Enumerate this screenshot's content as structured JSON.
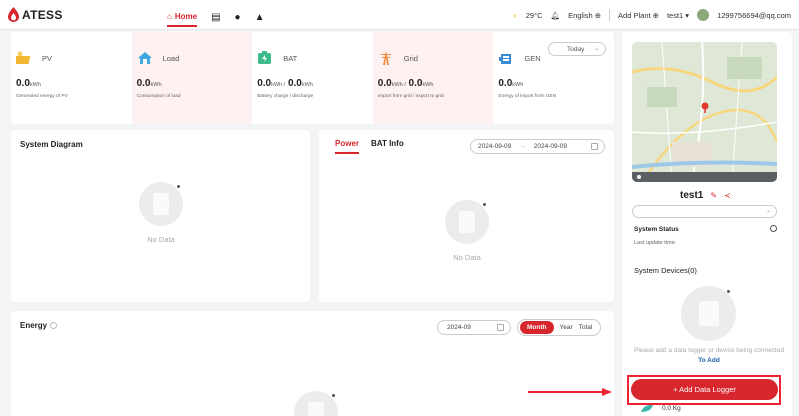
{
  "header": {
    "logo_text": "ATESS",
    "nav": {
      "home_label": "Home"
    },
    "weather": "29°C",
    "language": "English",
    "add_plant": "Add Plant",
    "plant_select": "test1",
    "account": "1299756694@qq.com"
  },
  "stats": {
    "period_select": "Today",
    "items": [
      {
        "name": "PV",
        "value": "0.0",
        "unit": "kWh",
        "desc": "Generated energy of PV"
      },
      {
        "name": "Load",
        "value": "0.0",
        "unit": "kWh",
        "desc": "Consumption of load"
      },
      {
        "name": "BAT",
        "value1": "0.0",
        "unit1": "kWh /",
        "value2": "0.0",
        "unit2": "kWh",
        "desc": "Battery charge / discharge"
      },
      {
        "name": "Grid",
        "value1": "0.0",
        "unit1": "kWh /",
        "value2": "0.0",
        "unit2": "kWh",
        "desc": "Import from grid / export to grid"
      },
      {
        "name": "GEN",
        "value": "0.0",
        "unit": "kWh",
        "desc": "Energy of import from GEN"
      }
    ]
  },
  "diagram": {
    "title": "System Diagram",
    "empty_text": "No Data"
  },
  "power": {
    "tab_power": "Power",
    "tab_bat": "BAT Info",
    "date_start": "2024-09-09",
    "date_sep": "→",
    "date_end": "2024-09-09",
    "empty_text": "No Data"
  },
  "energy": {
    "title": "Energy",
    "date": "2024-09",
    "toggle": {
      "month": "Month",
      "year": "Year",
      "total": "Total"
    }
  },
  "sidebar": {
    "plant_name": "test1",
    "system_status": "System Status",
    "last_update": "Last update time:",
    "system_devices": "System Devices(0)",
    "add_msg": "Please add a data logger or device being connected",
    "to_add": "To Add",
    "add_button": "+ Add Data Logger",
    "co2_value": "0.0 Kg"
  },
  "colors": {
    "accent": "#d7262d",
    "link": "#1b5fa8"
  }
}
